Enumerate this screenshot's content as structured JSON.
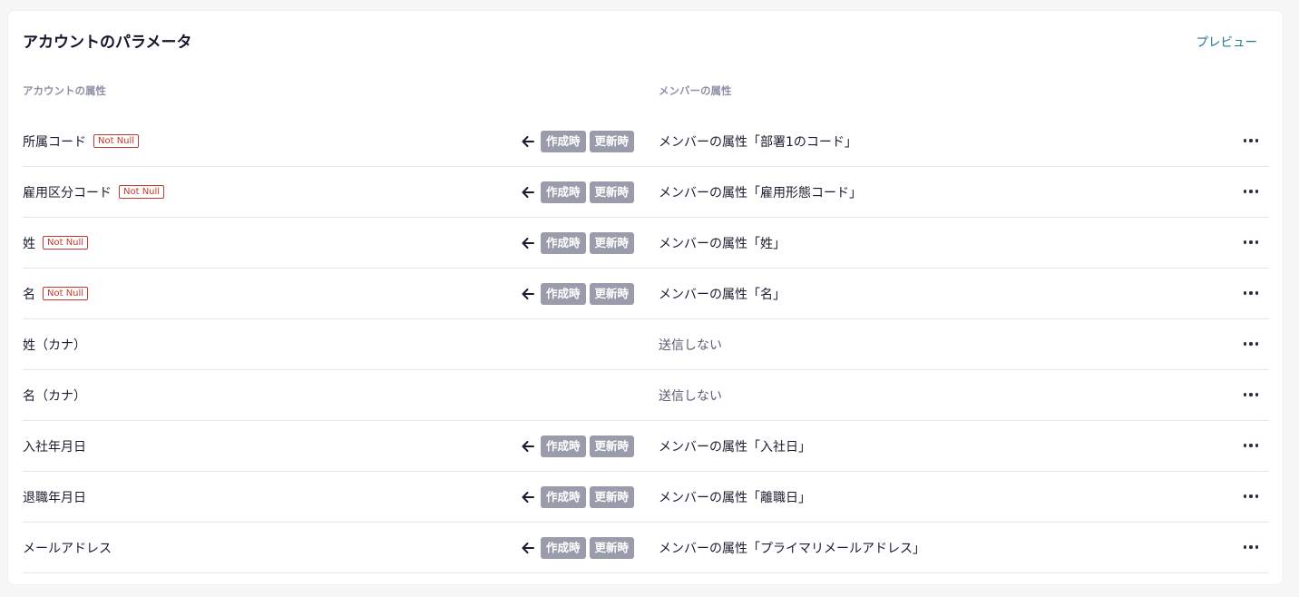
{
  "header": {
    "title": "アカウントのパラメータ",
    "preview_label": "プレビュー"
  },
  "columns": {
    "account": "アカウントの属性",
    "member": "メンバーの属性"
  },
  "badges": {
    "not_null": "Not Null",
    "on_create": "作成時",
    "on_update": "更新時"
  },
  "icons": {
    "arrow": "arrow-left-icon",
    "more": "more-horizontal-icon"
  },
  "colors": {
    "accent": "#1f7a8c",
    "not_null": "#c0392b",
    "tag_bg": "#9b9cab"
  },
  "rows": [
    {
      "account": "所属コード",
      "not_null": true,
      "mapped": true,
      "member": "メンバーの属性「部署1のコード」"
    },
    {
      "account": "雇用区分コード",
      "not_null": true,
      "mapped": true,
      "member": "メンバーの属性「雇用形態コード」"
    },
    {
      "account": "姓",
      "not_null": true,
      "mapped": true,
      "member": "メンバーの属性「姓」"
    },
    {
      "account": "名",
      "not_null": true,
      "mapped": true,
      "member": "メンバーの属性「名」"
    },
    {
      "account": "姓（カナ）",
      "not_null": false,
      "mapped": false,
      "member": "送信しない"
    },
    {
      "account": "名（カナ）",
      "not_null": false,
      "mapped": false,
      "member": "送信しない"
    },
    {
      "account": "入社年月日",
      "not_null": false,
      "mapped": true,
      "member": "メンバーの属性「入社日」"
    },
    {
      "account": "退職年月日",
      "not_null": false,
      "mapped": true,
      "member": "メンバーの属性「離職日」"
    },
    {
      "account": "メールアドレス",
      "not_null": false,
      "mapped": true,
      "member": "メンバーの属性「プライマリメールアドレス」"
    }
  ]
}
